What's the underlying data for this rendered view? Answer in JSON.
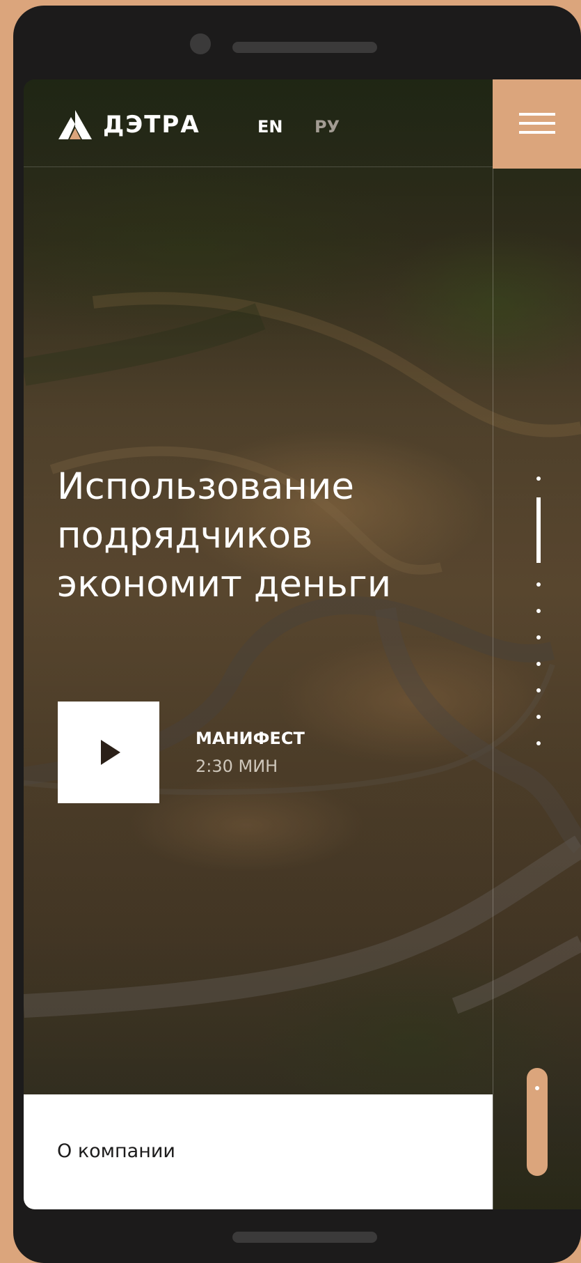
{
  "brand": {
    "name": "ДЭТРА",
    "accent_color": "#dba57c",
    "logo_icon": "detra-logo-icon"
  },
  "header": {
    "languages": [
      "EN",
      "РУ"
    ],
    "active_language": "EN",
    "menu_icon": "hamburger-menu-icon"
  },
  "hero": {
    "headline_lines": [
      "Использование",
      "подрядчиков",
      "экономит деньги"
    ]
  },
  "video": {
    "play_icon": "play-icon",
    "title": "МАНИФЕСТ",
    "duration": "2:30 МИН"
  },
  "slider": {
    "slide_count": 9,
    "active_index": 1
  },
  "footer_bar": {
    "label": "О компании"
  }
}
